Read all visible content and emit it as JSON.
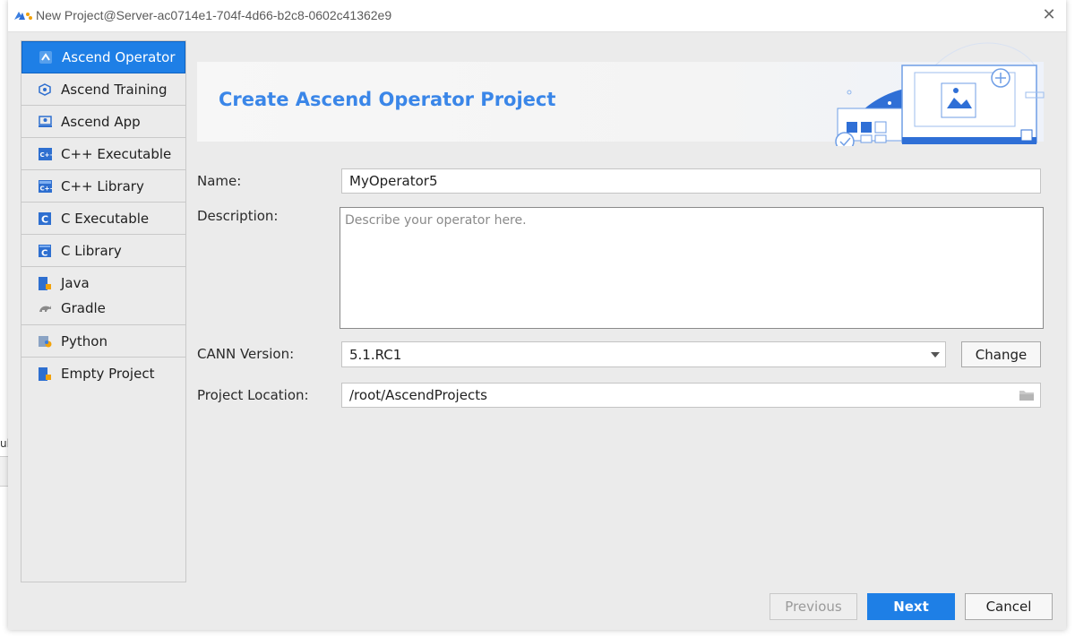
{
  "window": {
    "title": "New Project@Server-ac0714e1-704f-4d66-b2c8-0602c41362e9",
    "close_icon": "close-icon",
    "background_glyph": "ul"
  },
  "sidebar": {
    "items": [
      {
        "label": "Ascend Operator",
        "icon": "ascend-operator-icon",
        "selected": true
      },
      {
        "label": "Ascend Training",
        "icon": "ascend-training-icon"
      },
      {
        "label": "Ascend App",
        "icon": "ascend-app-icon"
      },
      {
        "label": "C++ Executable",
        "icon": "cpp-executable-icon"
      },
      {
        "label": "C++ Library",
        "icon": "cpp-library-icon"
      },
      {
        "label": "C Executable",
        "icon": "c-executable-icon"
      },
      {
        "label": "C Library",
        "icon": "c-library-icon"
      },
      {
        "label": "Java",
        "icon": "java-icon"
      },
      {
        "label": "Gradle",
        "icon": "gradle-icon"
      },
      {
        "label": "Python",
        "icon": "python-icon"
      },
      {
        "label": "Empty Project",
        "icon": "empty-project-icon"
      }
    ]
  },
  "banner": {
    "title": "Create Ascend Operator Project"
  },
  "form": {
    "name_label": "Name:",
    "name_value": "MyOperator5",
    "description_label": "Description:",
    "description_placeholder": "Describe your operator here.",
    "cann_label": "CANN Version:",
    "cann_value": "5.1.RC1",
    "change_label": "Change",
    "location_label": "Project Location:",
    "location_value": "/root/AscendProjects"
  },
  "footer": {
    "previous_label": "Previous",
    "next_label": "Next",
    "cancel_label": "Cancel"
  },
  "colors": {
    "accent": "#1e7fe6",
    "banner_title": "#3a86e8"
  }
}
